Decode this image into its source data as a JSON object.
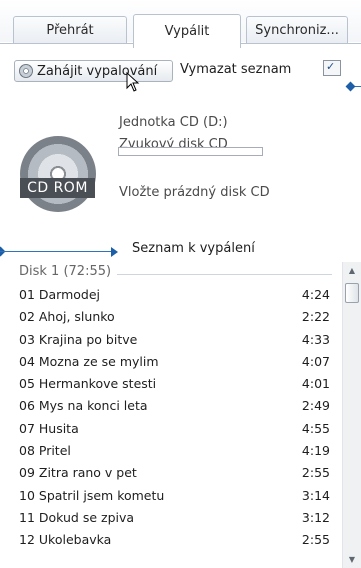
{
  "tabs": [
    {
      "label": "Přehrát"
    },
    {
      "label": "Vypálit",
      "active": true
    },
    {
      "label": "Synchroniz..."
    }
  ],
  "toolbar": {
    "burn_label": "Zahájit vypalování",
    "clear_label": "Vymazat seznam",
    "options_glyph": "✓"
  },
  "drive": {
    "cd_label": "CD ROM",
    "name": "Jednotka CD (D:)",
    "type": "Zvukový disk CD",
    "progress": 0,
    "instruction": "Vložte prázdný disk CD"
  },
  "burn_list": {
    "title": "Seznam k vypálení",
    "disk_header": "Disk 1 (72:55)",
    "tracks": [
      {
        "title": "01 Darmodej",
        "duration": "4:24"
      },
      {
        "title": "02 Ahoj, slunko",
        "duration": "2:22"
      },
      {
        "title": "03 Krajina po bitve",
        "duration": "4:33"
      },
      {
        "title": "04 Mozna ze se mylim",
        "duration": "4:07"
      },
      {
        "title": "05 Hermankove stesti",
        "duration": "4:01"
      },
      {
        "title": "06 Mys na konci leta",
        "duration": "2:49"
      },
      {
        "title": "07 Husita",
        "duration": "4:55"
      },
      {
        "title": "08 Pritel",
        "duration": "4:19"
      },
      {
        "title": "09 Zitra rano v pet",
        "duration": "2:55"
      },
      {
        "title": "10 Spatril jsem kometu",
        "duration": "3:14"
      },
      {
        "title": "11 Dokud se zpiva",
        "duration": "3:12"
      },
      {
        "title": "12 Ukolebavka",
        "duration": "2:55"
      }
    ]
  },
  "scrollbar": {
    "up_glyph": "▲",
    "down_glyph": "▼"
  },
  "colors": {
    "callout": "#1c5fa8",
    "tab_border": "#b9c3cf"
  }
}
